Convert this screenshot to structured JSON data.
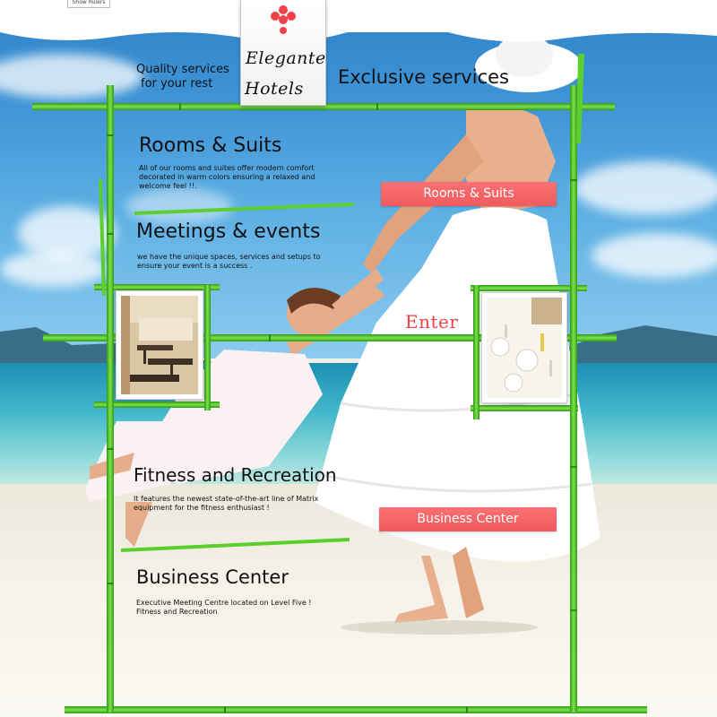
{
  "toolbar": {
    "top_tab_label": "Show Rulers"
  },
  "brand": {
    "line1": "Elegante",
    "line2": "Hotels",
    "accent_color": "#f2424a"
  },
  "header": {
    "tagline_line1": "Quality services",
    "tagline_line2": "for your rest",
    "exclusive": "Exclusive services"
  },
  "sections": [
    {
      "title": "Rooms & Suits",
      "text_line1": "All of our rooms and suites  offer modern comfort",
      "text_line2": "decorated in warm colors ensuring a relaxed and",
      "text_line3": "welcome feel !!."
    },
    {
      "title": "Meetings & events",
      "text_line1": "we have the unique spaces, services and setups to",
      "text_line2": "ensure your event is a success ."
    },
    {
      "title": "Fitness and Recreation",
      "text_line1": "It features the newest state-of-the-art line of Matrix",
      "text_line2": "equipment for the fitness enthusiast !"
    },
    {
      "title": "Business Center",
      "text_line1": "Executive Meeting Centre located on Level Five !",
      "text_line2": "Fitness and Recreation"
    }
  ],
  "buttons": {
    "rooms": "Rooms & Suits",
    "business": "Business Center",
    "enter": "Enter"
  },
  "colors": {
    "button_red": "#f26265",
    "bamboo_green": "#4cc62a",
    "sky": "#3f95d6"
  }
}
